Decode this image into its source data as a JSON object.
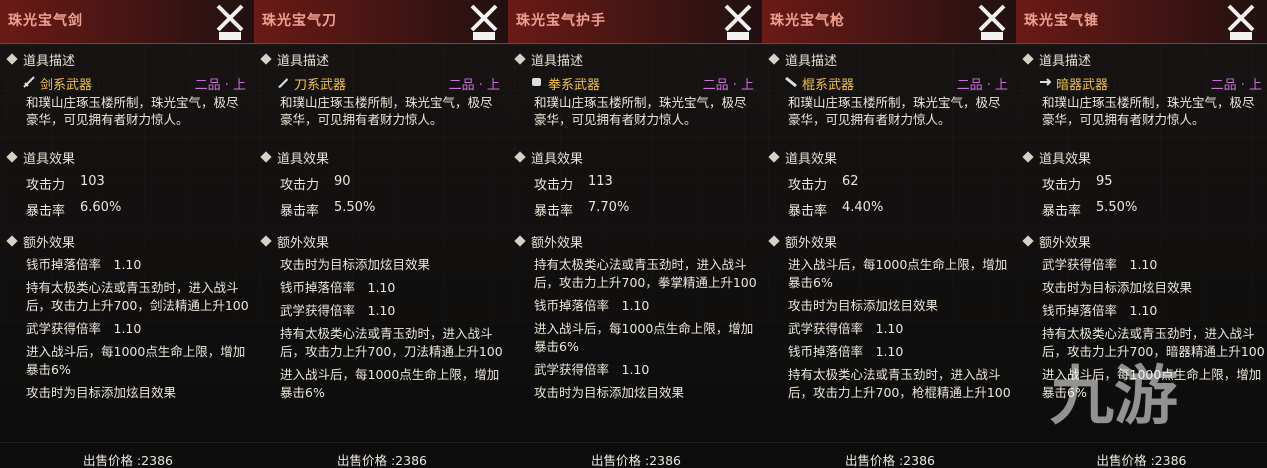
{
  "sections": {
    "desc": "道具描述",
    "effect": "道具效果",
    "extra": "额外效果"
  },
  "labels": {
    "atk": "攻击力",
    "crit": "暴击率"
  },
  "colors": {
    "weapon_type": "#f0c24a",
    "grade": "#d070e0",
    "header": "#6b1a16"
  },
  "panels": [
    {
      "title": "珠光宝气剑",
      "weapon_type": "剑系武器",
      "weapon_icon": "sword-icon",
      "grade": "二品 · 上",
      "description": "和璞山庄琢玉楼所制，珠光宝气，极尽豪华，可见拥有者财力惊人。",
      "atk": "103",
      "crit": "6.60%",
      "extras": [
        "钱币掉落倍率　1.10",
        "持有太极类心法或青玉劲时，进入战斗后，攻击力上升700，剑法精通上升100",
        "武学获得倍率　1.10",
        "进入战斗后，每1000点生命上限，增加暴击6%",
        "攻击时为目标添加炫目效果"
      ],
      "price": "出售价格 :2386"
    },
    {
      "title": "珠光宝气刀",
      "weapon_type": "刀系武器",
      "weapon_icon": "blade-icon",
      "grade": "二品 · 上",
      "description": "和璞山庄琢玉楼所制，珠光宝气，极尽豪华，可见拥有者财力惊人。",
      "atk": "90",
      "crit": "5.50%",
      "extras": [
        "攻击时为目标添加炫目效果",
        "钱币掉落倍率　1.10",
        "武学获得倍率　1.10",
        "持有太极类心法或青玉劲时，进入战斗后，攻击力上升700，刀法精通上升100",
        "进入战斗后，每1000点生命上限，增加暴击6%"
      ],
      "price": "出售价格 :2386"
    },
    {
      "title": "珠光宝气护手",
      "weapon_type": "拳系武器",
      "weapon_icon": "fist-icon",
      "grade": "二品 · 上",
      "description": "和璞山庄琢玉楼所制，珠光宝气，极尽豪华，可见拥有者财力惊人。",
      "atk": "113",
      "crit": "7.70%",
      "extras": [
        "持有太极类心法或青玉劲时，进入战斗后，攻击力上升700，拳掌精通上升100",
        "钱币掉落倍率　1.10",
        "进入战斗后，每1000点生命上限，增加暴击6%",
        "武学获得倍率　1.10",
        "攻击时为目标添加炫目效果"
      ],
      "price": "出售价格 :2386"
    },
    {
      "title": "珠光宝气枪",
      "weapon_type": "棍系武器",
      "weapon_icon": "staff-icon",
      "grade": "二品 · 上",
      "description": "和璞山庄琢玉楼所制，珠光宝气，极尽豪华，可见拥有者财力惊人。",
      "atk": "62",
      "crit": "4.40%",
      "extras": [
        "进入战斗后，每1000点生命上限，增加暴击6%",
        "攻击时为目标添加炫目效果",
        "武学获得倍率　1.10",
        "钱币掉落倍率　1.10",
        "持有太极类心法或青玉劲时，进入战斗后，攻击力上升700，枪棍精通上升100"
      ],
      "price": "出售价格 :2386"
    },
    {
      "title": "珠光宝气锥",
      "weapon_type": "暗器武器",
      "weapon_icon": "dart-icon",
      "grade": "二品 · 上",
      "description": "和璞山庄琢玉楼所制，珠光宝气，极尽豪华，可见拥有者财力惊人。",
      "atk": "95",
      "crit": "5.50%",
      "extras": [
        "武学获得倍率　1.10",
        "攻击时为目标添加炫目效果",
        "钱币掉落倍率　1.10",
        "持有太极类心法或青玉劲时，进入战斗后，攻击力上升700，暗器精通上升100",
        "进入战斗后，每1000点生命上限，增加暴击6%"
      ],
      "price": "出售价格 :2386"
    }
  ],
  "watermark": "九游"
}
